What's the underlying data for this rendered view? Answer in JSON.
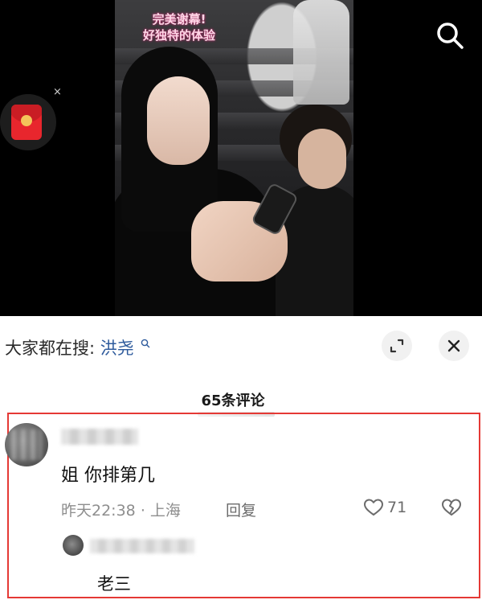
{
  "video": {
    "caption_line1": "完美谢幕!",
    "caption_line2": "好独特的体验"
  },
  "top_icons": {
    "search": "search-icon",
    "red_packet": "red-envelope-icon",
    "red_packet_close": "×"
  },
  "search_suggestion": {
    "prefix": "大家都在搜:",
    "term": "洪尧"
  },
  "header_buttons": {
    "expand": "expand-icon",
    "close": "close-icon"
  },
  "comments": {
    "count_label": "65条评论",
    "items": [
      {
        "text": "姐 你排第几",
        "time": "昨天22:38",
        "location": "上海",
        "reply_label": "回复",
        "likes": "71",
        "replies": [
          {
            "text": "老三"
          }
        ]
      }
    ]
  },
  "colors": {
    "highlight_border": "#e53935",
    "search_term": "#2d5a9c",
    "meta_text": "#8e8e8e"
  }
}
